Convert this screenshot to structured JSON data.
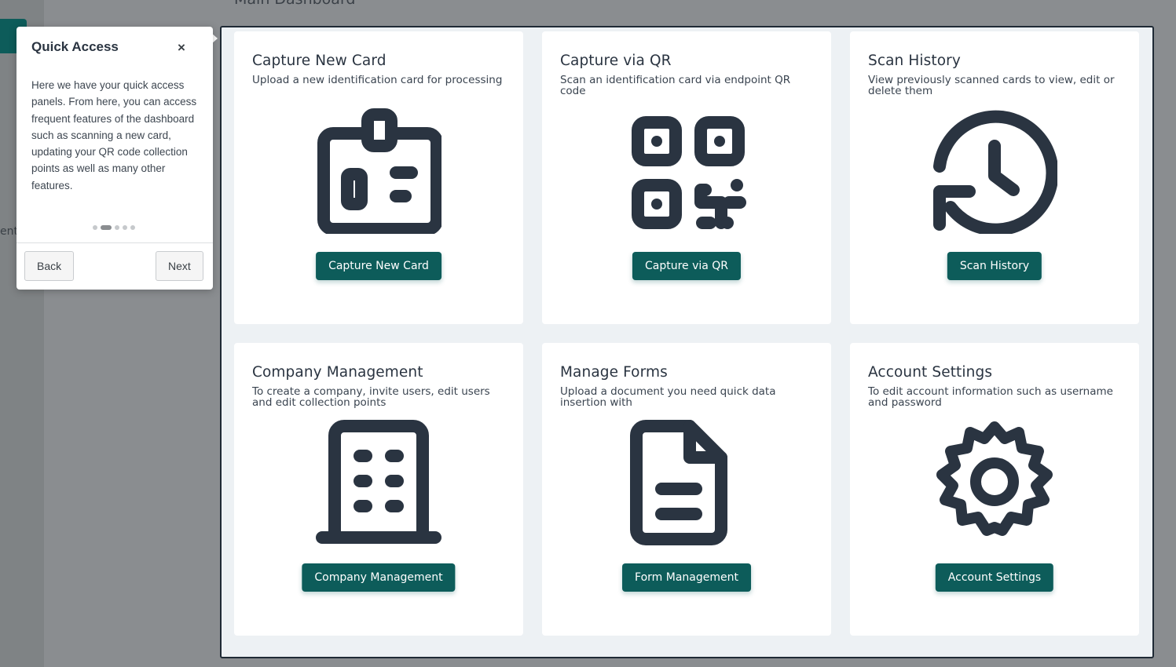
{
  "sidebar": {
    "partial_text": "ent"
  },
  "page": {
    "title": "Main Dashboard"
  },
  "cards": [
    {
      "title": "Capture New Card",
      "description": "Upload a new identification card for processing",
      "button": "Capture New Card",
      "icon": "id-card-icon"
    },
    {
      "title": "Capture via QR",
      "description": "Scan an identification card via endpoint QR code",
      "button": "Capture via QR",
      "icon": "qr-code-icon"
    },
    {
      "title": "Scan History",
      "description": "View previously scanned cards to view, edit or delete them",
      "button": "Scan History",
      "icon": "history-clock-icon"
    },
    {
      "title": "Company Management",
      "description": "To create a company, invite users, edit users and edit collection points",
      "button": "Company Management",
      "icon": "building-icon"
    },
    {
      "title": "Manage Forms",
      "description": "Upload a document you need quick data insertion with",
      "button": "Form Management",
      "icon": "document-icon"
    },
    {
      "title": "Account Settings",
      "description": "To edit account information such as username and password",
      "button": "Account Settings",
      "icon": "gear-icon"
    }
  ],
  "tour": {
    "title": "Quick Access",
    "close": "×",
    "body": "Here we have your quick access panels. From here, you can access frequent features of the dashboard such as scanning a new card, updating your QR code collection points as well as many other features.",
    "back": "Back",
    "next": "Next",
    "step": 2,
    "total_steps": 5
  },
  "colors": {
    "accent": "#0d5c5a",
    "icon": "#2a3441",
    "overlay": "#8a8d90"
  }
}
